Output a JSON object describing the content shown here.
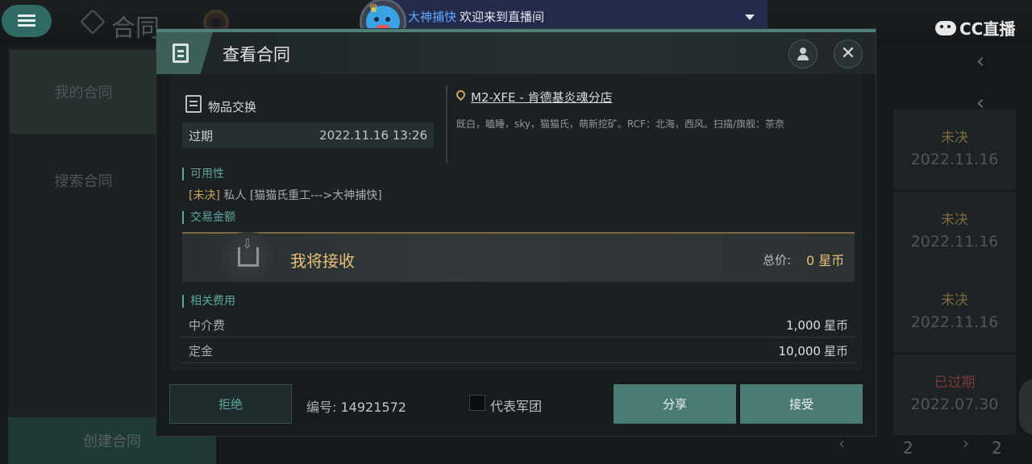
{
  "background": {
    "title": "合同",
    "sidebar": [
      "我的合同",
      "搜索合同"
    ],
    "create_button": "创建合同",
    "rows": [
      {
        "status": "未决",
        "date": "2022.11.16"
      },
      {
        "status": "未决",
        "date": "2022.11.16"
      },
      {
        "status": "未决",
        "date": "2022.11.16"
      },
      {
        "status": "已过期",
        "date": "2022.07.30"
      }
    ],
    "pager": {
      "current": "2",
      "total": "2"
    },
    "watermark": "CC直播"
  },
  "stream_banner": {
    "username": "大神捕快",
    "message": "欢迎来到直播间"
  },
  "dialog": {
    "title": "查看合同",
    "item_type": "物品交换",
    "expiry_label": "过期",
    "expiry_value": "2022.11.16 13:26",
    "location": "M2-XFE - 肯德基炎魂分店",
    "location_desc": "既白，瞌睡，sky，猫猫氏，萌新挖矿。RCF：北海，西风。扫描/旗舰：茶奈",
    "availability": {
      "heading": "可用性",
      "status": "[未决]",
      "detail": "私人 [猫猫氏重工--->大神捕快]"
    },
    "amount": {
      "heading": "交易金额",
      "receive_label": "我将接收",
      "total_label": "总价:",
      "total_value": "0 星币"
    },
    "fees": {
      "heading": "相关费用",
      "items": [
        {
          "label": "中介费",
          "value": "1,000",
          "unit": "星币"
        },
        {
          "label": "定金",
          "value": "10,000",
          "unit": "星币"
        }
      ]
    },
    "footer": {
      "reject": "拒绝",
      "contract_no_label": "编号:",
      "contract_no": "14921572",
      "corp_label": "代表军团",
      "share": "分享",
      "accept": "接受"
    }
  },
  "colors": {
    "accent": "#4a7b75",
    "gold": "#e6c07a",
    "section": "#5fa69b"
  }
}
